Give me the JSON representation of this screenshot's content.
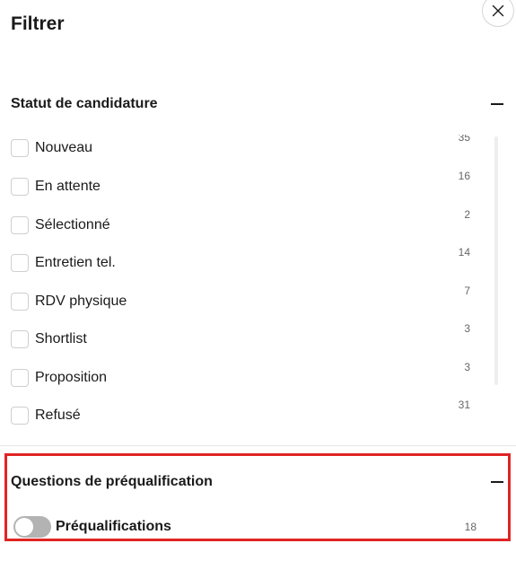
{
  "header": {
    "title": "Filtrer",
    "close_icon": "close-icon"
  },
  "status_section": {
    "title": "Statut de candidature",
    "collapse_icon": "minus-icon",
    "items": [
      {
        "label": "Nouveau",
        "count": "35"
      },
      {
        "label": "En attente",
        "count": "16"
      },
      {
        "label": "Sélectionné",
        "count": "2"
      },
      {
        "label": "Entretien tel.",
        "count": "14"
      },
      {
        "label": "RDV physique",
        "count": "7"
      },
      {
        "label": "Shortlist",
        "count": "3"
      },
      {
        "label": "Proposition",
        "count": "3"
      },
      {
        "label": "Refusé",
        "count": "31"
      }
    ]
  },
  "prequal_section": {
    "title": "Questions de préqualification",
    "collapse_icon": "minus-icon",
    "toggle": {
      "label": "Préqualifications",
      "count": "18",
      "enabled": false
    },
    "highlight_color": "#e02424"
  }
}
